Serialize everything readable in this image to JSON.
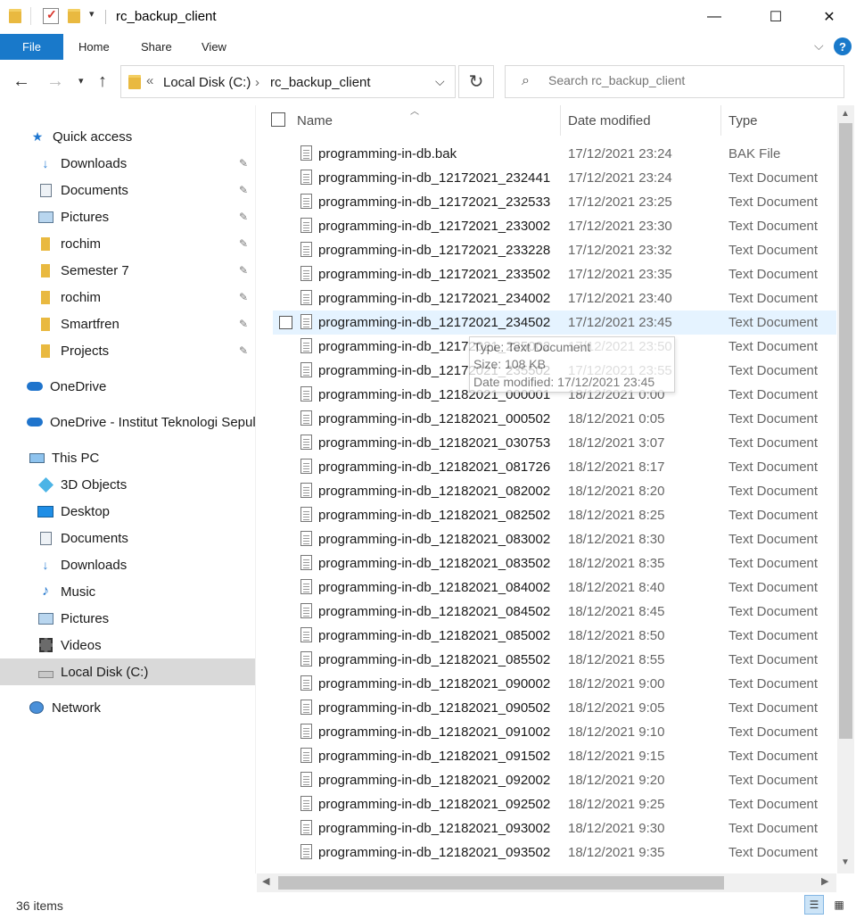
{
  "window": {
    "title": "rc_backup_client",
    "minimize": "—",
    "maximize": "☐",
    "close": "✕"
  },
  "ribbon": {
    "file": "File",
    "home": "Home",
    "share": "Share",
    "view": "View",
    "help": "?"
  },
  "address": {
    "overflow": "«",
    "crumbs": [
      "Local Disk (C:)",
      "rc_backup_client"
    ],
    "separator": "›"
  },
  "search": {
    "placeholder": "Search rc_backup_client"
  },
  "sidebar": {
    "items": [
      {
        "label": "Quick access",
        "icon": "star-icon",
        "pinned": false
      },
      {
        "label": "Downloads",
        "icon": "downloads-icon",
        "pinned": true
      },
      {
        "label": "Documents",
        "icon": "documents-icon",
        "pinned": true
      },
      {
        "label": "Pictures",
        "icon": "pictures-icon",
        "pinned": true
      },
      {
        "label": "rochim",
        "icon": "folder-icon",
        "pinned": true
      },
      {
        "label": "Semester 7",
        "icon": "folder-icon",
        "pinned": true
      },
      {
        "label": "rochim",
        "icon": "folder-icon",
        "pinned": true
      },
      {
        "label": "Smartfren",
        "icon": "folder-icon",
        "pinned": true
      },
      {
        "label": "Projects",
        "icon": "folder-icon",
        "pinned": true
      },
      {
        "label": "OneDrive",
        "icon": "onedrive-icon",
        "pinned": false
      },
      {
        "label": "OneDrive - Institut Teknologi Sepul",
        "icon": "onedrive-icon",
        "pinned": false
      },
      {
        "label": "This PC",
        "icon": "this-pc-icon",
        "pinned": false
      },
      {
        "label": "3D Objects",
        "icon": "3d-objects-icon",
        "pinned": false
      },
      {
        "label": "Desktop",
        "icon": "desktop-icon",
        "pinned": false
      },
      {
        "label": "Documents",
        "icon": "documents-icon",
        "pinned": false
      },
      {
        "label": "Downloads",
        "icon": "downloads-icon",
        "pinned": false
      },
      {
        "label": "Music",
        "icon": "music-icon",
        "pinned": false
      },
      {
        "label": "Pictures",
        "icon": "pictures-icon",
        "pinned": false
      },
      {
        "label": "Videos",
        "icon": "videos-icon",
        "pinned": false
      },
      {
        "label": "Local Disk (C:)",
        "icon": "local-disk-icon",
        "pinned": false,
        "selected": true
      },
      {
        "label": "Network",
        "icon": "network-icon",
        "pinned": false
      }
    ]
  },
  "columns": {
    "name": "Name",
    "date": "Date modified",
    "type": "Type"
  },
  "files": [
    {
      "name": "programming-in-db.bak",
      "date": "17/12/2021 23:24",
      "type": "BAK File"
    },
    {
      "name": "programming-in-db_12172021_232441",
      "date": "17/12/2021 23:24",
      "type": "Text Document"
    },
    {
      "name": "programming-in-db_12172021_232533",
      "date": "17/12/2021 23:25",
      "type": "Text Document"
    },
    {
      "name": "programming-in-db_12172021_233002",
      "date": "17/12/2021 23:30",
      "type": "Text Document"
    },
    {
      "name": "programming-in-db_12172021_233228",
      "date": "17/12/2021 23:32",
      "type": "Text Document"
    },
    {
      "name": "programming-in-db_12172021_233502",
      "date": "17/12/2021 23:35",
      "type": "Text Document"
    },
    {
      "name": "programming-in-db_12172021_234002",
      "date": "17/12/2021 23:40",
      "type": "Text Document"
    },
    {
      "name": "programming-in-db_12172021_234502",
      "date": "17/12/2021 23:45",
      "type": "Text Document",
      "hover": true
    },
    {
      "name": "programming-in-db_12172021_235002",
      "date": "17/12/2021 23:50",
      "type": "Text Document"
    },
    {
      "name": "programming-in-db_12172021_235502",
      "date": "17/12/2021 23:55",
      "type": "Text Document"
    },
    {
      "name": "programming-in-db_12182021_000001",
      "date": "18/12/2021 0:00",
      "type": "Text Document"
    },
    {
      "name": "programming-in-db_12182021_000502",
      "date": "18/12/2021 0:05",
      "type": "Text Document"
    },
    {
      "name": "programming-in-db_12182021_030753",
      "date": "18/12/2021 3:07",
      "type": "Text Document"
    },
    {
      "name": "programming-in-db_12182021_081726",
      "date": "18/12/2021 8:17",
      "type": "Text Document"
    },
    {
      "name": "programming-in-db_12182021_082002",
      "date": "18/12/2021 8:20",
      "type": "Text Document"
    },
    {
      "name": "programming-in-db_12182021_082502",
      "date": "18/12/2021 8:25",
      "type": "Text Document"
    },
    {
      "name": "programming-in-db_12182021_083002",
      "date": "18/12/2021 8:30",
      "type": "Text Document"
    },
    {
      "name": "programming-in-db_12182021_083502",
      "date": "18/12/2021 8:35",
      "type": "Text Document"
    },
    {
      "name": "programming-in-db_12182021_084002",
      "date": "18/12/2021 8:40",
      "type": "Text Document"
    },
    {
      "name": "programming-in-db_12182021_084502",
      "date": "18/12/2021 8:45",
      "type": "Text Document"
    },
    {
      "name": "programming-in-db_12182021_085002",
      "date": "18/12/2021 8:50",
      "type": "Text Document"
    },
    {
      "name": "programming-in-db_12182021_085502",
      "date": "18/12/2021 8:55",
      "type": "Text Document"
    },
    {
      "name": "programming-in-db_12182021_090002",
      "date": "18/12/2021 9:00",
      "type": "Text Document"
    },
    {
      "name": "programming-in-db_12182021_090502",
      "date": "18/12/2021 9:05",
      "type": "Text Document"
    },
    {
      "name": "programming-in-db_12182021_091002",
      "date": "18/12/2021 9:10",
      "type": "Text Document"
    },
    {
      "name": "programming-in-db_12182021_091502",
      "date": "18/12/2021 9:15",
      "type": "Text Document"
    },
    {
      "name": "programming-in-db_12182021_092002",
      "date": "18/12/2021 9:20",
      "type": "Text Document"
    },
    {
      "name": "programming-in-db_12182021_092502",
      "date": "18/12/2021 9:25",
      "type": "Text Document"
    },
    {
      "name": "programming-in-db_12182021_093002",
      "date": "18/12/2021 9:30",
      "type": "Text Document"
    },
    {
      "name": "programming-in-db_12182021_093502",
      "date": "18/12/2021 9:35",
      "type": "Text Document"
    }
  ],
  "tooltip": {
    "type": "Type: Text Document",
    "size": "Size: 108 KB",
    "date": "Date modified: 17/12/2021 23:45"
  },
  "status": {
    "count": "36 items"
  },
  "colors": {
    "accent": "#1979ca",
    "selection": "#d9d9d9",
    "hover": "#e5f3ff"
  }
}
